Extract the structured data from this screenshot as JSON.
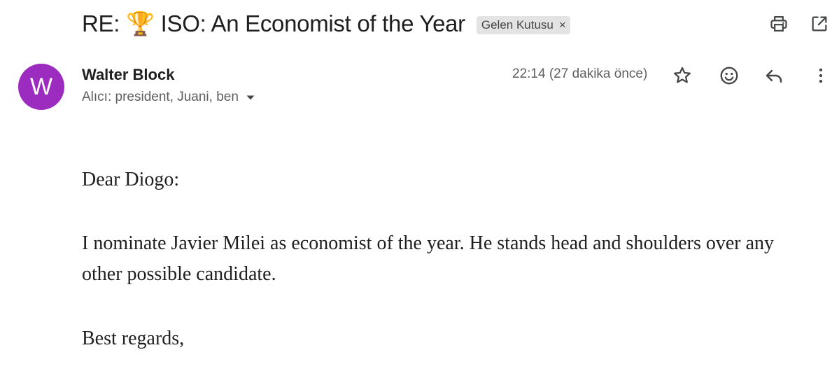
{
  "message": {
    "subject": "RE: 🏆 ISO: An Economist of the Year",
    "label": "Gelen Kutusu",
    "label_remove": "×",
    "sender": {
      "name": "Walter Block",
      "avatar_letter": "W",
      "avatar_color": "#9c2cc0"
    },
    "recipients": "Alıcı: president, Juani, ben",
    "time": "22:14 (27 dakika önce)",
    "body": {
      "greeting": "Dear Diogo:",
      "paragraph": "I nominate Javier Milei as economist of the year. He stands head and shoulders over any other possible candidate.",
      "closing": "Best regards,"
    }
  },
  "toolbar": {
    "icons": [
      "printer-icon",
      "open-in-new-window-icon"
    ]
  },
  "message_actions": {
    "icons": [
      "star-icon",
      "emoji-reaction-icon",
      "reply-icon",
      "more-options-icon"
    ]
  }
}
